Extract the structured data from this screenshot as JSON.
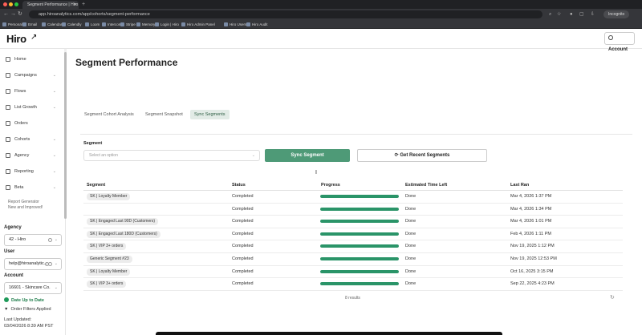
{
  "browser": {
    "tab_title": "Segment Performance | Hiro",
    "tab_close": "×",
    "new_tab": "+",
    "url": "app.hiroanalytics.com/app/cohorts/segment-performance",
    "incognito_label": "Incognito",
    "bookmarks": [
      "Personal",
      "Email",
      "Calendar",
      "Calendly",
      "Loom",
      "Intercom",
      "Stripe",
      "Memory",
      "Login | Hiro",
      "Hiro Admin Panel",
      "Hiro Users",
      "Hiro Audit"
    ]
  },
  "header": {
    "logo": "Hiro",
    "logo_arrow": "↗",
    "account_label": "Account"
  },
  "sidebar": {
    "items": [
      {
        "label": "Home",
        "chevron": ""
      },
      {
        "label": "Campaigns",
        "chevron": "⌄"
      },
      {
        "label": "Flows",
        "chevron": "⌄"
      },
      {
        "label": "List Growth",
        "chevron": "⌄"
      },
      {
        "label": "Orders",
        "chevron": ""
      },
      {
        "label": "Cohorts",
        "chevron": "⌄"
      },
      {
        "label": "Agency",
        "chevron": "⌄"
      },
      {
        "label": "Reporting",
        "chevron": "⌄"
      },
      {
        "label": "Beta",
        "chevron": "⌄"
      }
    ],
    "report_generator_line1": "Report Generator",
    "report_generator_line2": "New and Improved!",
    "agency_label": "Agency",
    "agency_value": "42 - Hiro",
    "user_label": "User",
    "user_value": "help@hiroanalytic...",
    "account_label": "Account",
    "account_value": "16601 - Skincare Co.",
    "status_text": "Date Up to Date",
    "filters_text": "Order Filters Applied",
    "last_updated_label": "Last Updated:",
    "last_updated_value": "03/04/2026 8:39 AM PST"
  },
  "main": {
    "title": "Segment Performance",
    "tabs": [
      {
        "label": "Segment Cohort Analysis",
        "active": false
      },
      {
        "label": "Segment Snapshot",
        "active": false
      },
      {
        "label": "Sync Segments",
        "active": true
      }
    ],
    "segment_label": "Segment",
    "segment_placeholder": "Select an option",
    "sync_button": "Sync Segment",
    "recent_button": "Get Recent Segments",
    "table": {
      "headers": [
        "Segment",
        "Status",
        "Progress",
        "Estimated Time Left",
        "Last Ran"
      ],
      "rows": [
        {
          "segment": "SK | Loyalty Member",
          "status": "Completed",
          "progress": 1.0,
          "time_left": "Done",
          "last_ran": "Mar 4, 2026 1:37 PM"
        },
        {
          "segment": "",
          "status": "Completed",
          "progress": 1.0,
          "time_left": "Done",
          "last_ran": "Mar 4, 2026 1:34 PM"
        },
        {
          "segment": "SK | Engaged Last 90D (Customers)",
          "status": "Completed",
          "progress": 1.0,
          "time_left": "Done",
          "last_ran": "Mar 4, 2026 1:01 PM"
        },
        {
          "segment": "SK | Engaged Last 180D (Customers)",
          "status": "Completed",
          "progress": 1.0,
          "time_left": "Done",
          "last_ran": "Feb 4, 2026 1:11 PM"
        },
        {
          "segment": "SK | VIP 3+ orders",
          "status": "Completed",
          "progress": 1.0,
          "time_left": "Done",
          "last_ran": "Nov 19, 2025 1:12 PM"
        },
        {
          "segment": "Generic Segment #23",
          "status": "Completed",
          "progress": 1.0,
          "time_left": "Done",
          "last_ran": "Nov 19, 2025 12:53 PM"
        },
        {
          "segment": "SK | Loyalty Member",
          "status": "Completed",
          "progress": 1.0,
          "time_left": "Done",
          "last_ran": "Oct 16, 2025 3:15 PM"
        },
        {
          "segment": "SK | VIP 3+ orders",
          "status": "Completed",
          "progress": 1.0,
          "time_left": "Done",
          "last_ran": "Sep 22, 2025 4:23 PM"
        }
      ]
    },
    "results_text": "8 results"
  },
  "colors": {
    "accent": "#4e9a77",
    "progress": "#2a9468",
    "active_tab_bg": "#e2ebe6"
  }
}
